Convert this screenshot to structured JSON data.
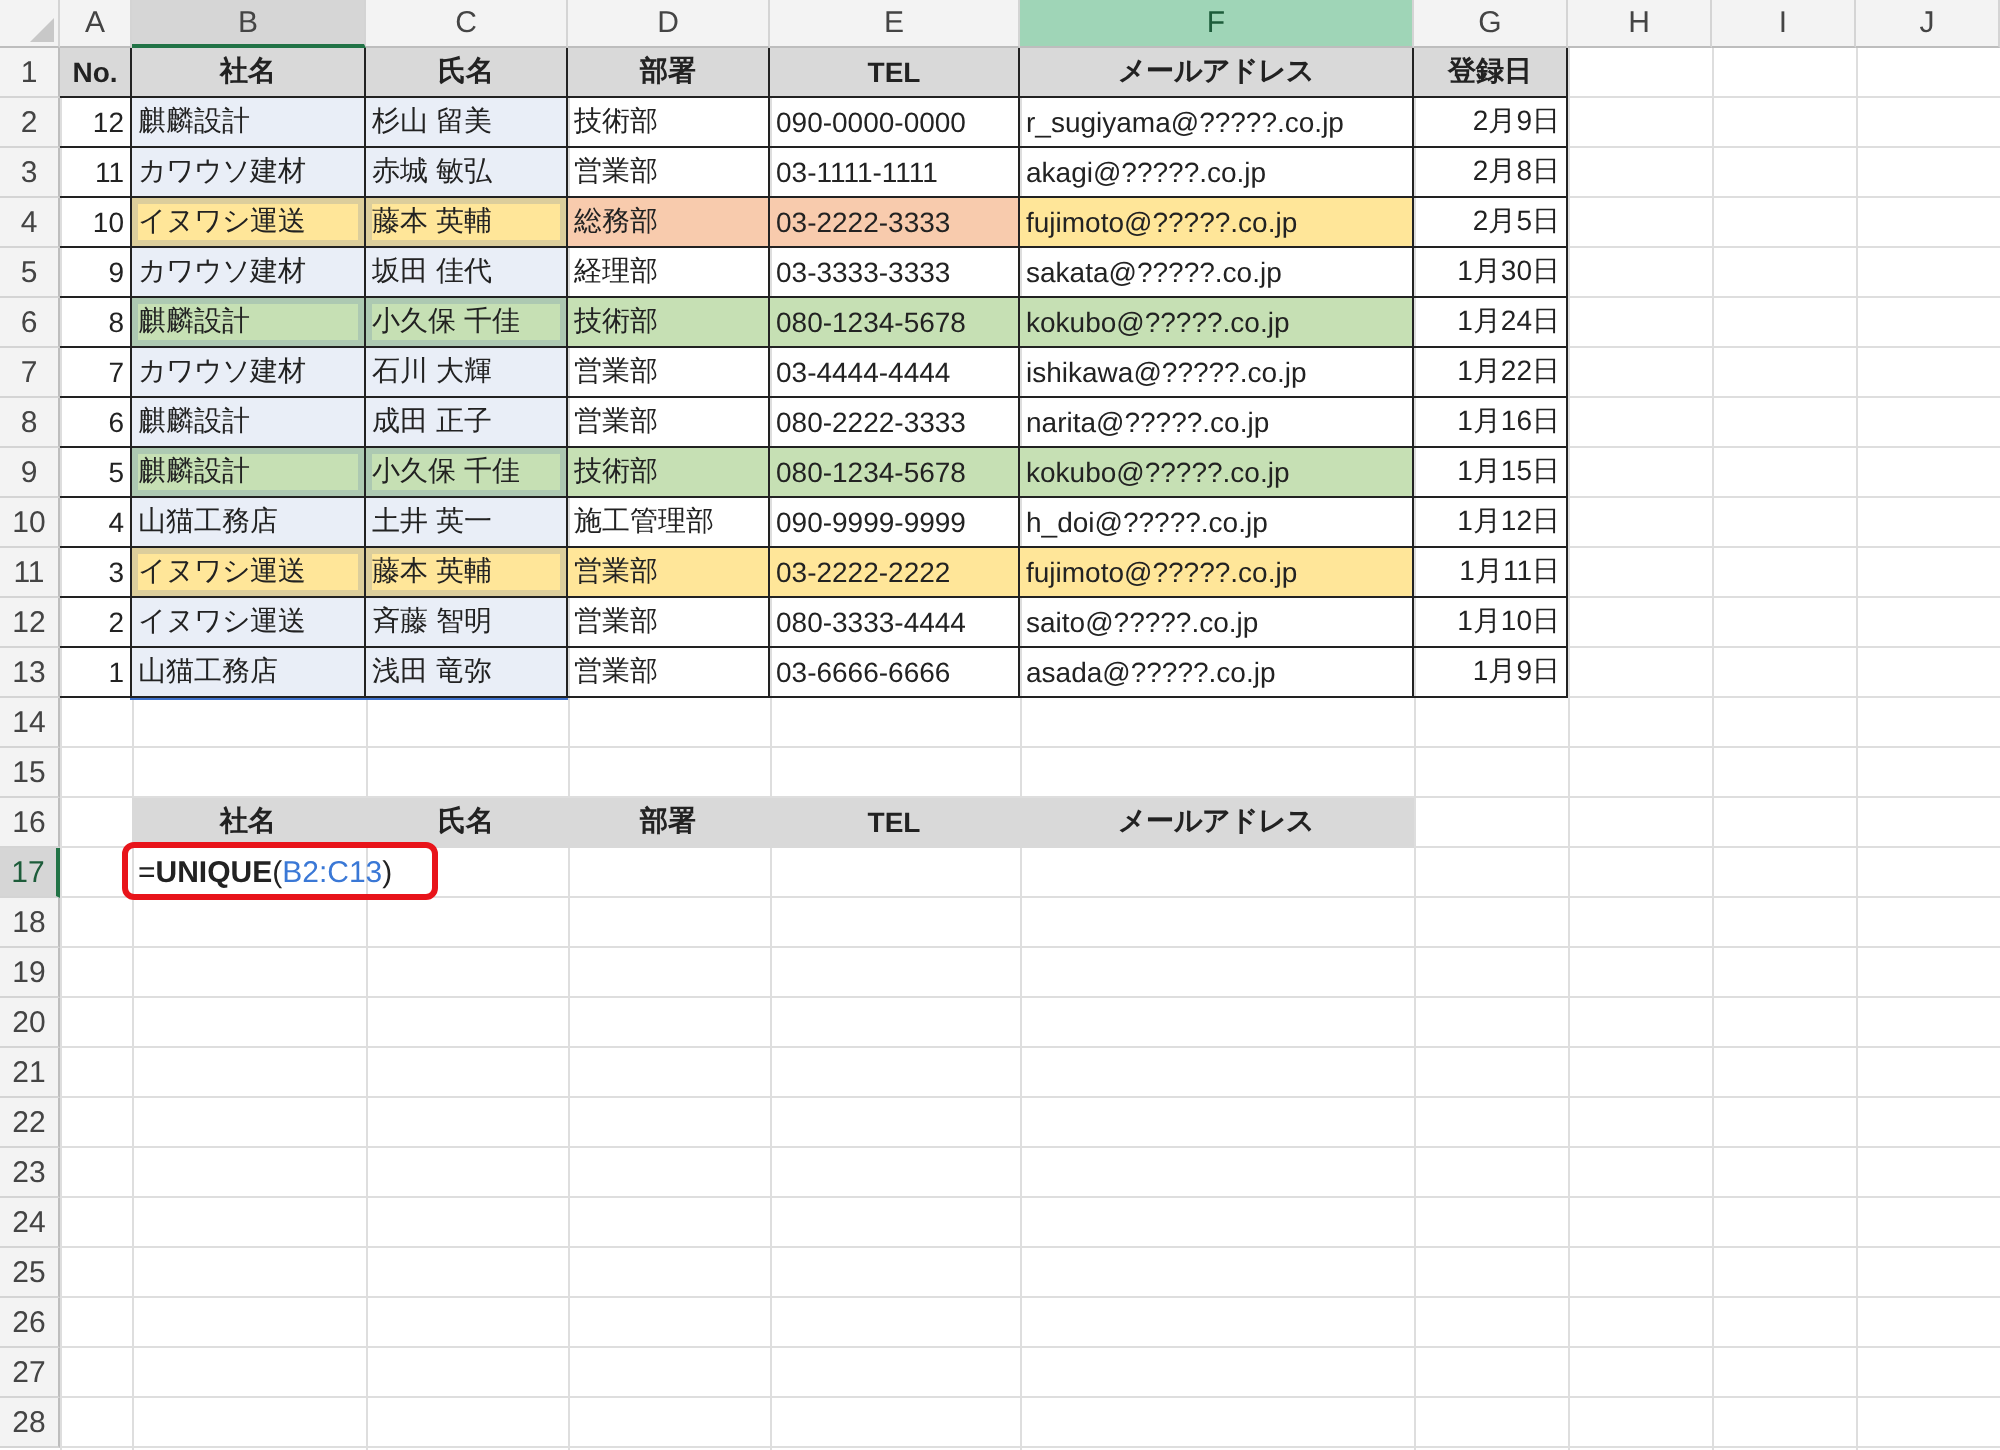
{
  "columns": [
    {
      "label": "A",
      "selected": false,
      "highlighted": false
    },
    {
      "label": "B",
      "selected": false,
      "highlighted": true
    },
    {
      "label": "C",
      "selected": false,
      "highlighted": false
    },
    {
      "label": "D",
      "selected": false,
      "highlighted": false
    },
    {
      "label": "E",
      "selected": false,
      "highlighted": false
    },
    {
      "label": "F",
      "selected": true,
      "highlighted": false
    },
    {
      "label": "G",
      "selected": false,
      "highlighted": false
    },
    {
      "label": "H",
      "selected": false,
      "highlighted": false
    },
    {
      "label": "I",
      "selected": false,
      "highlighted": false
    },
    {
      "label": "J",
      "selected": false,
      "highlighted": false
    }
  ],
  "rows": [
    {
      "number": "1",
      "highlighted": false,
      "kind": "table-header",
      "cells": [
        {
          "text": "No.",
          "selected": false
        },
        {
          "text": "社名",
          "selected": false
        },
        {
          "text": "氏名",
          "selected": false
        },
        {
          "text": "部署",
          "selected": false
        },
        {
          "text": "TEL",
          "selected": false
        },
        {
          "text": "メールアドレス",
          "selected": false
        },
        {
          "text": "登録日",
          "selected": false
        }
      ]
    },
    {
      "number": "2",
      "highlighted": false,
      "kind": "table",
      "cells": [
        {
          "text": "12",
          "selected": false
        },
        {
          "text": "麒麟設計",
          "selected": true
        },
        {
          "text": "杉山 留美",
          "selected": true
        },
        {
          "text": "技術部",
          "selected": false
        },
        {
          "text": "090-0000-0000",
          "selected": false
        },
        {
          "text": "r_sugiyama@?????.co.jp",
          "selected": false
        },
        {
          "text": "2月9日",
          "selected": false
        }
      ]
    },
    {
      "number": "3",
      "highlighted": false,
      "kind": "table",
      "cells": [
        {
          "text": "11",
          "selected": false
        },
        {
          "text": "カワウソ建材",
          "selected": true
        },
        {
          "text": "赤城 敏弘",
          "selected": true
        },
        {
          "text": "営業部",
          "selected": false
        },
        {
          "text": "03-1111-1111",
          "selected": false
        },
        {
          "text": "akagi@?????.co.jp",
          "selected": false
        },
        {
          "text": "2月8日",
          "selected": false
        }
      ]
    },
    {
      "number": "4",
      "highlighted": false,
      "kind": "table",
      "cells": [
        {
          "text": "10",
          "selected": false
        },
        {
          "text": "イヌワシ運送",
          "selected": true,
          "color": "#ffe699"
        },
        {
          "text": "藤本 英輔",
          "selected": true,
          "color": "#ffe699"
        },
        {
          "text": "総務部",
          "selected": false,
          "color": "#f8cbad"
        },
        {
          "text": "03-2222-3333",
          "selected": false,
          "color": "#f8cbad"
        },
        {
          "text": "fujimoto@?????.co.jp",
          "selected": false,
          "color": "#ffe699"
        },
        {
          "text": "2月5日",
          "selected": false
        }
      ]
    },
    {
      "number": "5",
      "highlighted": false,
      "kind": "table",
      "cells": [
        {
          "text": "9",
          "selected": false
        },
        {
          "text": "カワウソ建材",
          "selected": true
        },
        {
          "text": "坂田 佳代",
          "selected": true
        },
        {
          "text": "経理部",
          "selected": false
        },
        {
          "text": "03-3333-3333",
          "selected": false
        },
        {
          "text": "sakata@?????.co.jp",
          "selected": false
        },
        {
          "text": "1月30日",
          "selected": false
        }
      ]
    },
    {
      "number": "6",
      "highlighted": false,
      "kind": "table",
      "cells": [
        {
          "text": "8",
          "selected": false
        },
        {
          "text": "麒麟設計",
          "selected": true,
          "color": "#c6e0b4"
        },
        {
          "text": "小久保 千佳",
          "selected": true,
          "color": "#c6e0b4"
        },
        {
          "text": "技術部",
          "selected": false,
          "color": "#c6e0b4"
        },
        {
          "text": "080-1234-5678",
          "selected": false,
          "color": "#c6e0b4"
        },
        {
          "text": "kokubo@?????.co.jp",
          "selected": false,
          "color": "#c6e0b4"
        },
        {
          "text": "1月24日",
          "selected": false
        }
      ]
    },
    {
      "number": "7",
      "highlighted": false,
      "kind": "table",
      "cells": [
        {
          "text": "7",
          "selected": false
        },
        {
          "text": "カワウソ建材",
          "selected": true
        },
        {
          "text": "石川 大輝",
          "selected": true
        },
        {
          "text": "営業部",
          "selected": false
        },
        {
          "text": "03-4444-4444",
          "selected": false
        },
        {
          "text": "ishikawa@?????.co.jp",
          "selected": false
        },
        {
          "text": "1月22日",
          "selected": false
        }
      ]
    },
    {
      "number": "8",
      "highlighted": false,
      "kind": "table",
      "cells": [
        {
          "text": "6",
          "selected": false
        },
        {
          "text": "麒麟設計",
          "selected": true
        },
        {
          "text": "成田 正子",
          "selected": true
        },
        {
          "text": "営業部",
          "selected": false
        },
        {
          "text": "080-2222-3333",
          "selected": false
        },
        {
          "text": "narita@?????.co.jp",
          "selected": false
        },
        {
          "text": "1月16日",
          "selected": false
        }
      ]
    },
    {
      "number": "9",
      "highlighted": false,
      "kind": "table",
      "cells": [
        {
          "text": "5",
          "selected": false
        },
        {
          "text": "麒麟設計",
          "selected": true,
          "color": "#c6e0b4"
        },
        {
          "text": "小久保 千佳",
          "selected": true,
          "color": "#c6e0b4"
        },
        {
          "text": "技術部",
          "selected": false,
          "color": "#c6e0b4"
        },
        {
          "text": "080-1234-5678",
          "selected": false,
          "color": "#c6e0b4"
        },
        {
          "text": "kokubo@?????.co.jp",
          "selected": false,
          "color": "#c6e0b4"
        },
        {
          "text": "1月15日",
          "selected": false
        }
      ]
    },
    {
      "number": "10",
      "highlighted": false,
      "kind": "table",
      "cells": [
        {
          "text": "4",
          "selected": false
        },
        {
          "text": "山猫工務店",
          "selected": true
        },
        {
          "text": "土井 英一",
          "selected": true
        },
        {
          "text": "施工管理部",
          "selected": false
        },
        {
          "text": "090-9999-9999",
          "selected": false
        },
        {
          "text": "h_doi@?????.co.jp",
          "selected": false
        },
        {
          "text": "1月12日",
          "selected": false
        }
      ]
    },
    {
      "number": "11",
      "highlighted": false,
      "kind": "table",
      "cells": [
        {
          "text": "3",
          "selected": false
        },
        {
          "text": "イヌワシ運送",
          "selected": true,
          "color": "#ffe699"
        },
        {
          "text": "藤本 英輔",
          "selected": true,
          "color": "#ffe699"
        },
        {
          "text": "営業部",
          "selected": false,
          "color": "#ffe699"
        },
        {
          "text": "03-2222-2222",
          "selected": false,
          "color": "#ffe699"
        },
        {
          "text": "fujimoto@?????.co.jp",
          "selected": false,
          "color": "#ffe699"
        },
        {
          "text": "1月11日",
          "selected": false
        }
      ]
    },
    {
      "number": "12",
      "highlighted": false,
      "kind": "table",
      "cells": [
        {
          "text": "2",
          "selected": false
        },
        {
          "text": "イヌワシ運送",
          "selected": true
        },
        {
          "text": "斉藤 智明",
          "selected": true
        },
        {
          "text": "営業部",
          "selected": false
        },
        {
          "text": "080-3333-4444",
          "selected": false
        },
        {
          "text": "saito@?????.co.jp",
          "selected": false
        },
        {
          "text": "1月10日",
          "selected": false
        }
      ]
    },
    {
      "number": "13",
      "highlighted": false,
      "kind": "table",
      "cells": [
        {
          "text": "1",
          "selected": false
        },
        {
          "text": "山猫工務店",
          "selected": true
        },
        {
          "text": "浅田 竜弥",
          "selected": true
        },
        {
          "text": "営業部",
          "selected": false
        },
        {
          "text": "03-6666-6666",
          "selected": false
        },
        {
          "text": "asada@?????.co.jp",
          "selected": false
        },
        {
          "text": "1月9日",
          "selected": false
        }
      ]
    },
    {
      "number": "14",
      "highlighted": false,
      "kind": "blank"
    },
    {
      "number": "15",
      "highlighted": false,
      "kind": "blank"
    },
    {
      "number": "16",
      "highlighted": false,
      "kind": "result-header",
      "cells": [
        {
          "text": "社名"
        },
        {
          "text": "氏名"
        },
        {
          "text": "部署"
        },
        {
          "text": "TEL"
        },
        {
          "text": "メールアドレス"
        }
      ]
    },
    {
      "number": "17",
      "highlighted": true,
      "kind": "formula",
      "formula": {
        "head": "=**UNIQUE**(",
        "reference": "B2:C13",
        "tail": ")"
      }
    },
    {
      "number": "18",
      "highlighted": false,
      "kind": "blank"
    },
    {
      "number": "19",
      "highlighted": false,
      "kind": "blank"
    },
    {
      "number": "20",
      "highlighted": false,
      "kind": "blank"
    },
    {
      "number": "21",
      "highlighted": false,
      "kind": "blank"
    },
    {
      "number": "22",
      "highlighted": false,
      "kind": "blank"
    },
    {
      "number": "23",
      "highlighted": false,
      "kind": "blank"
    },
    {
      "number": "24",
      "highlighted": false,
      "kind": "blank"
    },
    {
      "number": "25",
      "highlighted": false,
      "kind": "blank"
    },
    {
      "number": "26",
      "highlighted": false,
      "kind": "blank"
    },
    {
      "number": "27",
      "highlighted": false,
      "kind": "blank"
    },
    {
      "number": "28",
      "highlighted": false,
      "kind": "blank"
    }
  ]
}
